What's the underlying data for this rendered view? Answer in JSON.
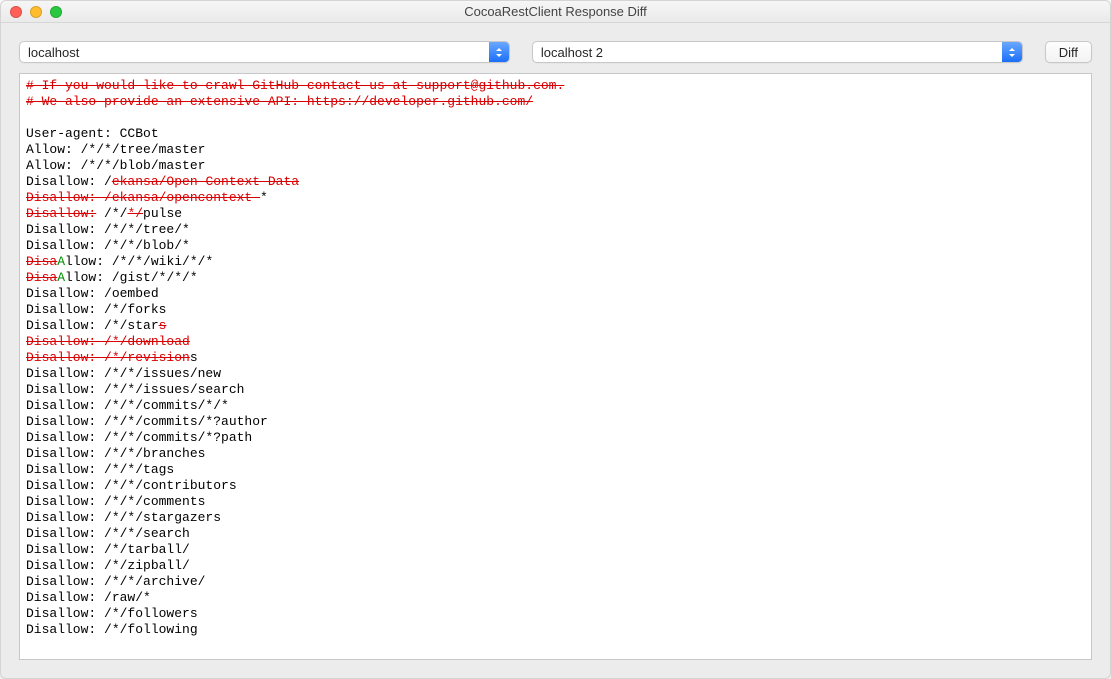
{
  "window": {
    "title": "CocoaRestClient Response Diff"
  },
  "toolbar": {
    "left_select": "localhost",
    "right_select": "localhost 2",
    "diff_button": "Diff"
  },
  "diff_lines": [
    [
      [
        "del",
        "# If you would like to crawl GitHub contact us at support@github.com."
      ]
    ],
    [
      [
        "del",
        "# We also provide an extensive API: https://developer.github.com/"
      ]
    ],
    [],
    [
      [
        "n",
        "User-agent: CCBot"
      ]
    ],
    [
      [
        "n",
        "Allow: /*/*/tree/master"
      ]
    ],
    [
      [
        "n",
        "Allow: /*/*/blob/master"
      ]
    ],
    [
      [
        "n",
        "Disallow: /"
      ],
      [
        "del",
        "ekansa/Open-Context-Data"
      ]
    ],
    [
      [
        "del",
        "Disallow: /ekansa/opencontext-"
      ],
      [
        "n",
        "*"
      ]
    ],
    [
      [
        "del",
        "Disallow:"
      ],
      [
        "n",
        " /*/"
      ],
      [
        "del",
        "*/"
      ],
      [
        "n",
        "pulse"
      ]
    ],
    [
      [
        "n",
        "Disallow: /*/*/tree/*"
      ]
    ],
    [
      [
        "n",
        "Disallow: /*/*/blob/*"
      ]
    ],
    [
      [
        "del",
        "Disa"
      ],
      [
        "ins",
        "A"
      ],
      [
        "n",
        "llow: /*/*/wiki/*/*"
      ]
    ],
    [
      [
        "del",
        "Disa"
      ],
      [
        "ins",
        "A"
      ],
      [
        "n",
        "llow: /gist/*/*/*"
      ]
    ],
    [
      [
        "n",
        "Disallow: /oembed"
      ]
    ],
    [
      [
        "n",
        "Disallow: /*/forks"
      ]
    ],
    [
      [
        "n",
        "Disallow: /*/star"
      ],
      [
        "del",
        "s"
      ]
    ],
    [
      [
        "del",
        "Disallow: /*/download"
      ]
    ],
    [
      [
        "del",
        "Disallow: /*/revision"
      ],
      [
        "n",
        "s"
      ]
    ],
    [
      [
        "n",
        "Disallow: /*/*/issues/new"
      ]
    ],
    [
      [
        "n",
        "Disallow: /*/*/issues/search"
      ]
    ],
    [
      [
        "n",
        "Disallow: /*/*/commits/*/*"
      ]
    ],
    [
      [
        "n",
        "Disallow: /*/*/commits/*?author"
      ]
    ],
    [
      [
        "n",
        "Disallow: /*/*/commits/*?path"
      ]
    ],
    [
      [
        "n",
        "Disallow: /*/*/branches"
      ]
    ],
    [
      [
        "n",
        "Disallow: /*/*/tags"
      ]
    ],
    [
      [
        "n",
        "Disallow: /*/*/contributors"
      ]
    ],
    [
      [
        "n",
        "Disallow: /*/*/comments"
      ]
    ],
    [
      [
        "n",
        "Disallow: /*/*/stargazers"
      ]
    ],
    [
      [
        "n",
        "Disallow: /*/*/search"
      ]
    ],
    [
      [
        "n",
        "Disallow: /*/tarball/"
      ]
    ],
    [
      [
        "n",
        "Disallow: /*/zipball/"
      ]
    ],
    [
      [
        "n",
        "Disallow: /*/*/archive/"
      ]
    ],
    [
      [
        "n",
        "Disallow: /raw/*"
      ]
    ],
    [
      [
        "n",
        "Disallow: /*/followers"
      ]
    ],
    [
      [
        "n",
        "Disallow: /*/following"
      ]
    ]
  ]
}
